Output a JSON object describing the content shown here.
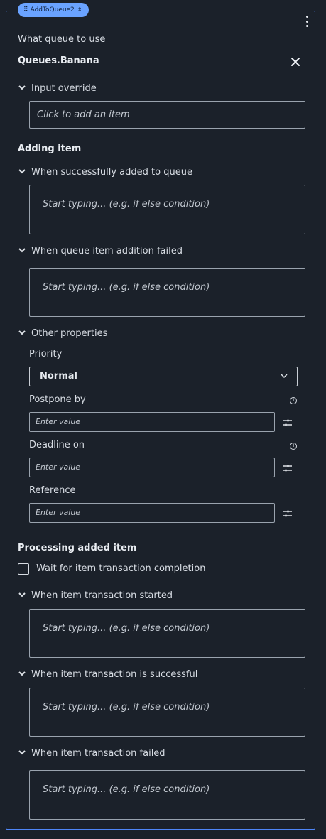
{
  "activity": {
    "name": "AddToQueue2"
  },
  "queue": {
    "label": "What queue to use",
    "value": "Queues.Banana"
  },
  "input_override": {
    "label": "Input override",
    "placeholder": "Click to add an item"
  },
  "adding_item": {
    "heading": "Adding item",
    "success": {
      "label": "When successfully added to queue",
      "placeholder": "Start typing... (e.g. if else condition)"
    },
    "failed": {
      "label": "When queue item addition failed",
      "placeholder": "Start typing... (e.g. if else condition)"
    }
  },
  "other_properties": {
    "label": "Other properties",
    "priority": {
      "label": "Priority",
      "value": "Normal"
    },
    "postpone": {
      "label": "Postpone by",
      "placeholder": "Enter value"
    },
    "deadline": {
      "label": "Deadline on",
      "placeholder": "Enter value"
    },
    "reference": {
      "label": "Reference",
      "placeholder": "Enter value"
    }
  },
  "processing": {
    "heading": "Processing added item",
    "wait_checkbox": {
      "label": "Wait for item transaction completion",
      "checked": false
    },
    "started": {
      "label": "When item transaction started",
      "placeholder": "Start typing... (e.g. if else condition)"
    },
    "successful": {
      "label": "When item transaction is successful",
      "placeholder": "Start typing... (e.g. if else condition)"
    },
    "failed": {
      "label": "When item transaction failed",
      "placeholder": "Start typing... (e.g. if else condition)"
    }
  },
  "colors": {
    "background": "#1b212a",
    "accent": "#4f86f7",
    "tag": "#6aa3ff"
  }
}
